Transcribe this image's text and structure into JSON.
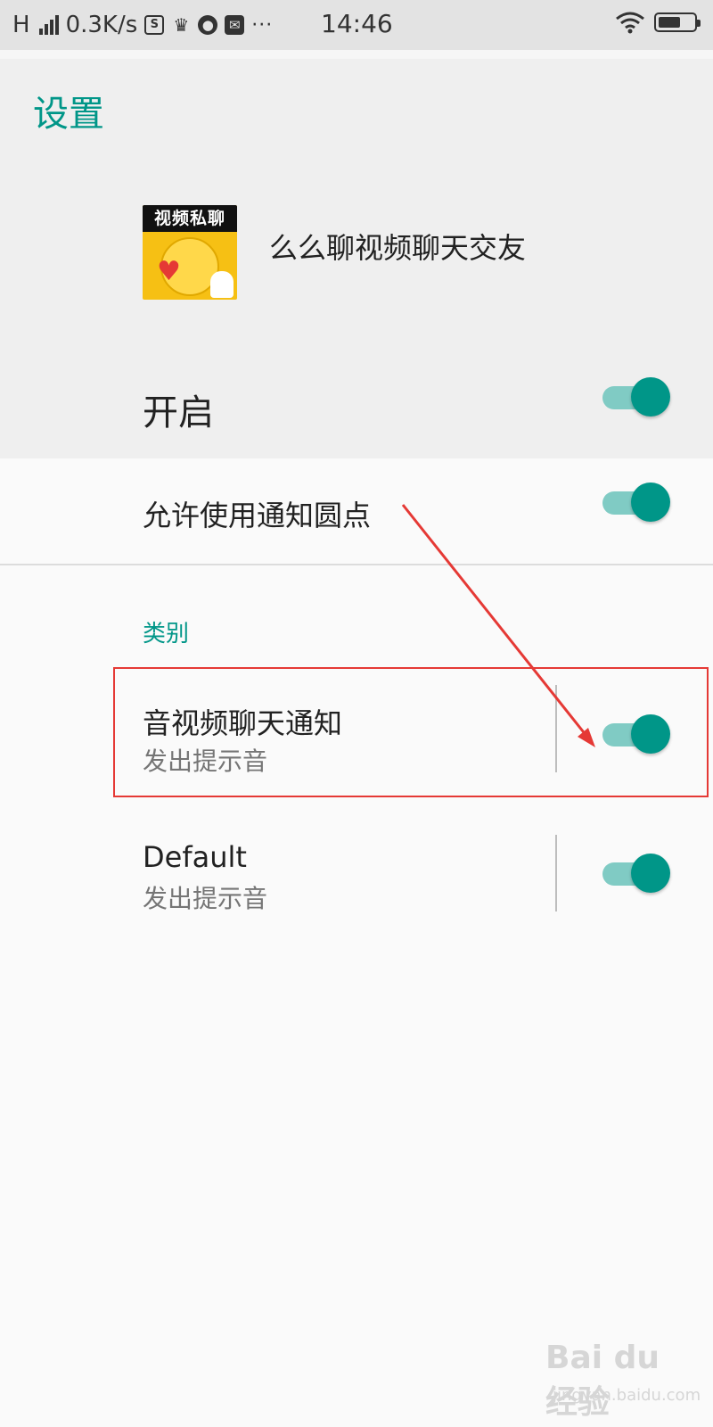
{
  "status_bar": {
    "network": "H",
    "speed": "0.3K/s",
    "time": "14:46",
    "icons": [
      "sim-icon",
      "crown-icon",
      "planet-icon",
      "message-icon",
      "more-icon",
      "wifi-icon",
      "battery-icon"
    ],
    "battery_level": 0.6
  },
  "page": {
    "title": "设置"
  },
  "app": {
    "icon_banner_text": "视频私聊",
    "name": "么么聊视频聊天交友"
  },
  "master": {
    "label": "开启",
    "enabled": true
  },
  "notification_dots": {
    "label": "允许使用通知圆点",
    "enabled": true
  },
  "categories": {
    "header": "类别",
    "items": [
      {
        "title": "音视频聊天通知",
        "subtitle": "发出提示音",
        "enabled": true
      },
      {
        "title": "Default",
        "subtitle": "发出提示音",
        "enabled": true
      }
    ]
  },
  "colors": {
    "accent": "#009688",
    "annotation": "#e53935"
  },
  "watermark": {
    "brand": "Bai du 经验",
    "url": "jingyan.baidu.com"
  }
}
